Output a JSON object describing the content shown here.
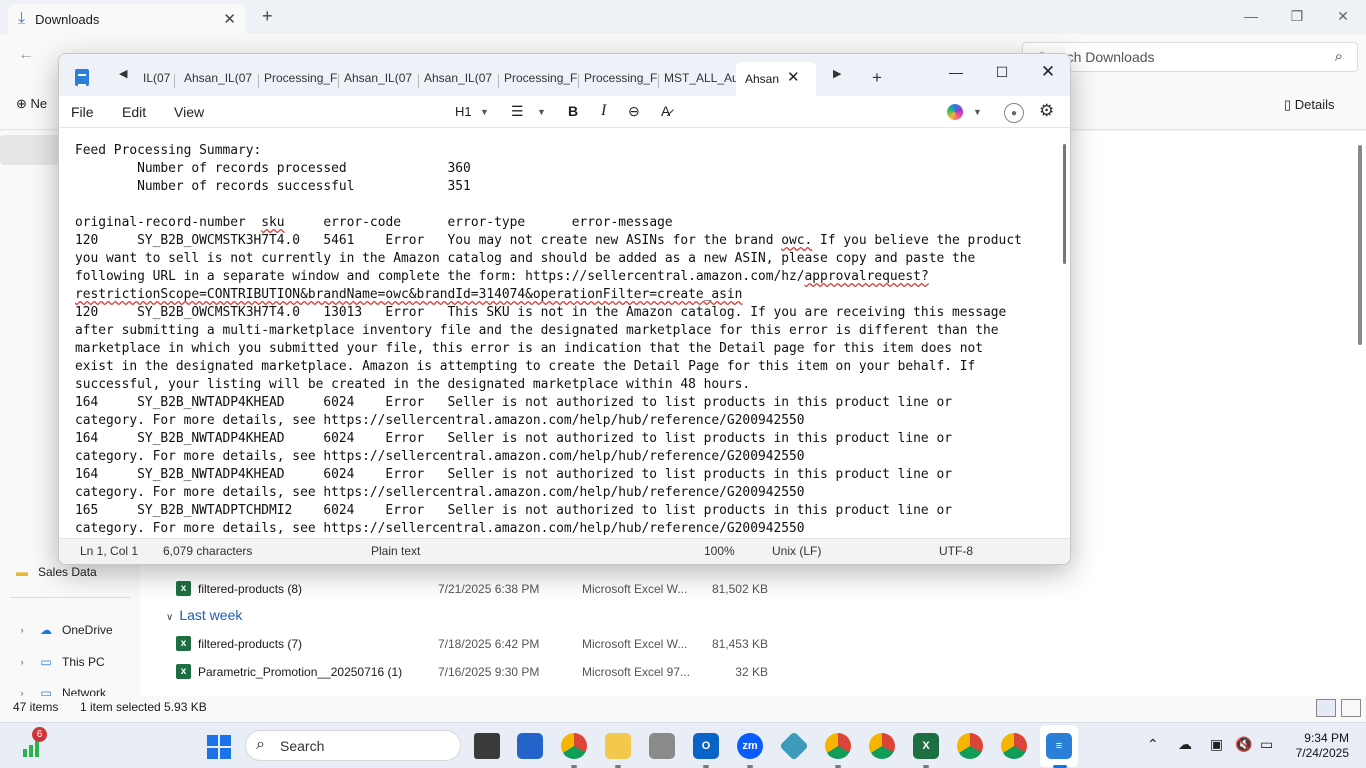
{
  "explorer": {
    "tab_title": "Downloads",
    "search_placeholder": "Search Downloads",
    "new_label": "Ne",
    "details_label": "Details",
    "nav": {
      "onedrive": "OneDrive",
      "this_pc": "This PC",
      "network": "Network",
      "sales_data": "Sales Data"
    },
    "files": [
      {
        "name": "filtered-products (8)",
        "date": "7/21/2025 6:38 PM",
        "type": "Microsoft Excel W...",
        "size": "81,502 KB"
      },
      {
        "name": "filtered-products (7)",
        "date": "7/18/2025 6:42 PM",
        "type": "Microsoft Excel W...",
        "size": "81,453 KB"
      },
      {
        "name": "Parametric_Promotion__20250716 (1)",
        "date": "7/16/2025 9:30 PM",
        "type": "Microsoft Excel 97...",
        "size": "32 KB"
      }
    ],
    "group_last_week": "Last week",
    "status": {
      "items": "47 items",
      "selected": "1 item selected  5.93 KB"
    }
  },
  "notepad": {
    "tabs": [
      "IL(07",
      "Ahsan_IL(07",
      "Processing_F",
      "Ahsan_IL(07",
      "Ahsan_IL(07",
      "Processing_F",
      "Processing_F",
      "MST_ALL_Au"
    ],
    "active_tab": "Ahsan",
    "menu": {
      "file": "File",
      "edit": "Edit",
      "view": "View"
    },
    "heading_select": "H1",
    "lines": [
      "Feed Processing Summary:",
      "        Number of records processed             360",
      "        Number of records successful            351",
      "",
      "original-record-number  sku     error-code      error-type      error-message",
      "120     SY_B2B_OWCMSTK3H7T4.0   5461    Error   You may not create new ASINs for the brand owc. If you believe the product",
      "you want to sell is not currently in the Amazon catalog and should be added as a new ASIN, please copy and paste the",
      "following URL in a separate window and complete the form: https://sellercentral.amazon.com/hz/approvalrequest?",
      "restrictionScope=CONTRIBUTION&brandName=owc&brandId=314074&operationFilter=create_asin",
      "120     SY_B2B_OWCMSTK3H7T4.0   13013   Error   This SKU is not in the Amazon catalog. If you are receiving this message",
      "after submitting a multi-marketplace inventory file and the designated marketplace for this error is different than the",
      "marketplace in which you submitted your file, this error is an indication that the Detail page for this item does not",
      "exist in the designated marketplace. Amazon is attempting to create the Detail Page for this item on your behalf. If",
      "successful, your listing will be created in the designated marketplace within 48 hours.",
      "164     SY_B2B_NWTADP4KHEAD     6024    Error   Seller is not authorized to list products in this product line or",
      "category. For more details, see https://sellercentral.amazon.com/help/hub/reference/G200942550",
      "164     SY_B2B_NWTADP4KHEAD     6024    Error   Seller is not authorized to list products in this product line or",
      "category. For more details, see https://sellercentral.amazon.com/help/hub/reference/G200942550",
      "164     SY_B2B_NWTADP4KHEAD     6024    Error   Seller is not authorized to list products in this product line or",
      "category. For more details, see https://sellercentral.amazon.com/help/hub/reference/G200942550",
      "165     SY_B2B_NWTADPTCHDMI2    6024    Error   Seller is not authorized to list products in this product line or",
      "category. For more details, see https://sellercentral.amazon.com/help/hub/reference/G200942550"
    ],
    "status": {
      "position": "Ln 1, Col 1",
      "characters": "6,079 characters",
      "format": "Plain text",
      "zoom": "100%",
      "line_endings": "Unix (LF)",
      "encoding": "UTF-8"
    }
  },
  "taskbar": {
    "search_label": "Search",
    "widget_badge": "6",
    "time": "9:34 PM",
    "date": "7/24/2025",
    "zoom_app": "zm"
  }
}
